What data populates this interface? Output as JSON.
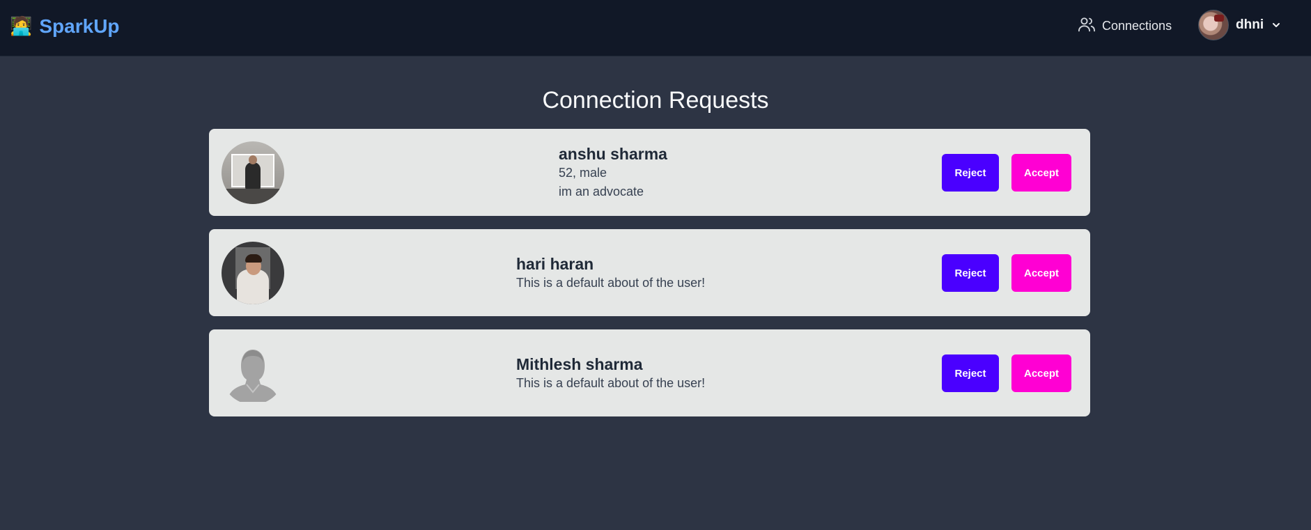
{
  "navbar": {
    "brand_emoji": "🧑‍💻",
    "brand_name": "SparkUp",
    "connections_label": "Connections",
    "user_name": "dhni"
  },
  "page": {
    "title": "Connection Requests"
  },
  "requests": [
    {
      "name": "anshu sharma",
      "age_gender": "52, male",
      "about": "im an advocate",
      "reject_label": "Reject",
      "accept_label": "Accept"
    },
    {
      "name": "hari haran",
      "about": "This is a default about of the user!",
      "reject_label": "Reject",
      "accept_label": "Accept"
    },
    {
      "name": "Mithlesh sharma",
      "about": "This is a default about of the user!",
      "reject_label": "Reject",
      "accept_label": "Accept"
    }
  ],
  "colors": {
    "navbar_bg": "#111827",
    "page_bg": "#2d3444",
    "brand": "#60a5fa",
    "reject": "#4a00ff",
    "accept": "#ff00d3",
    "card_bg": "#e5e7e6"
  }
}
